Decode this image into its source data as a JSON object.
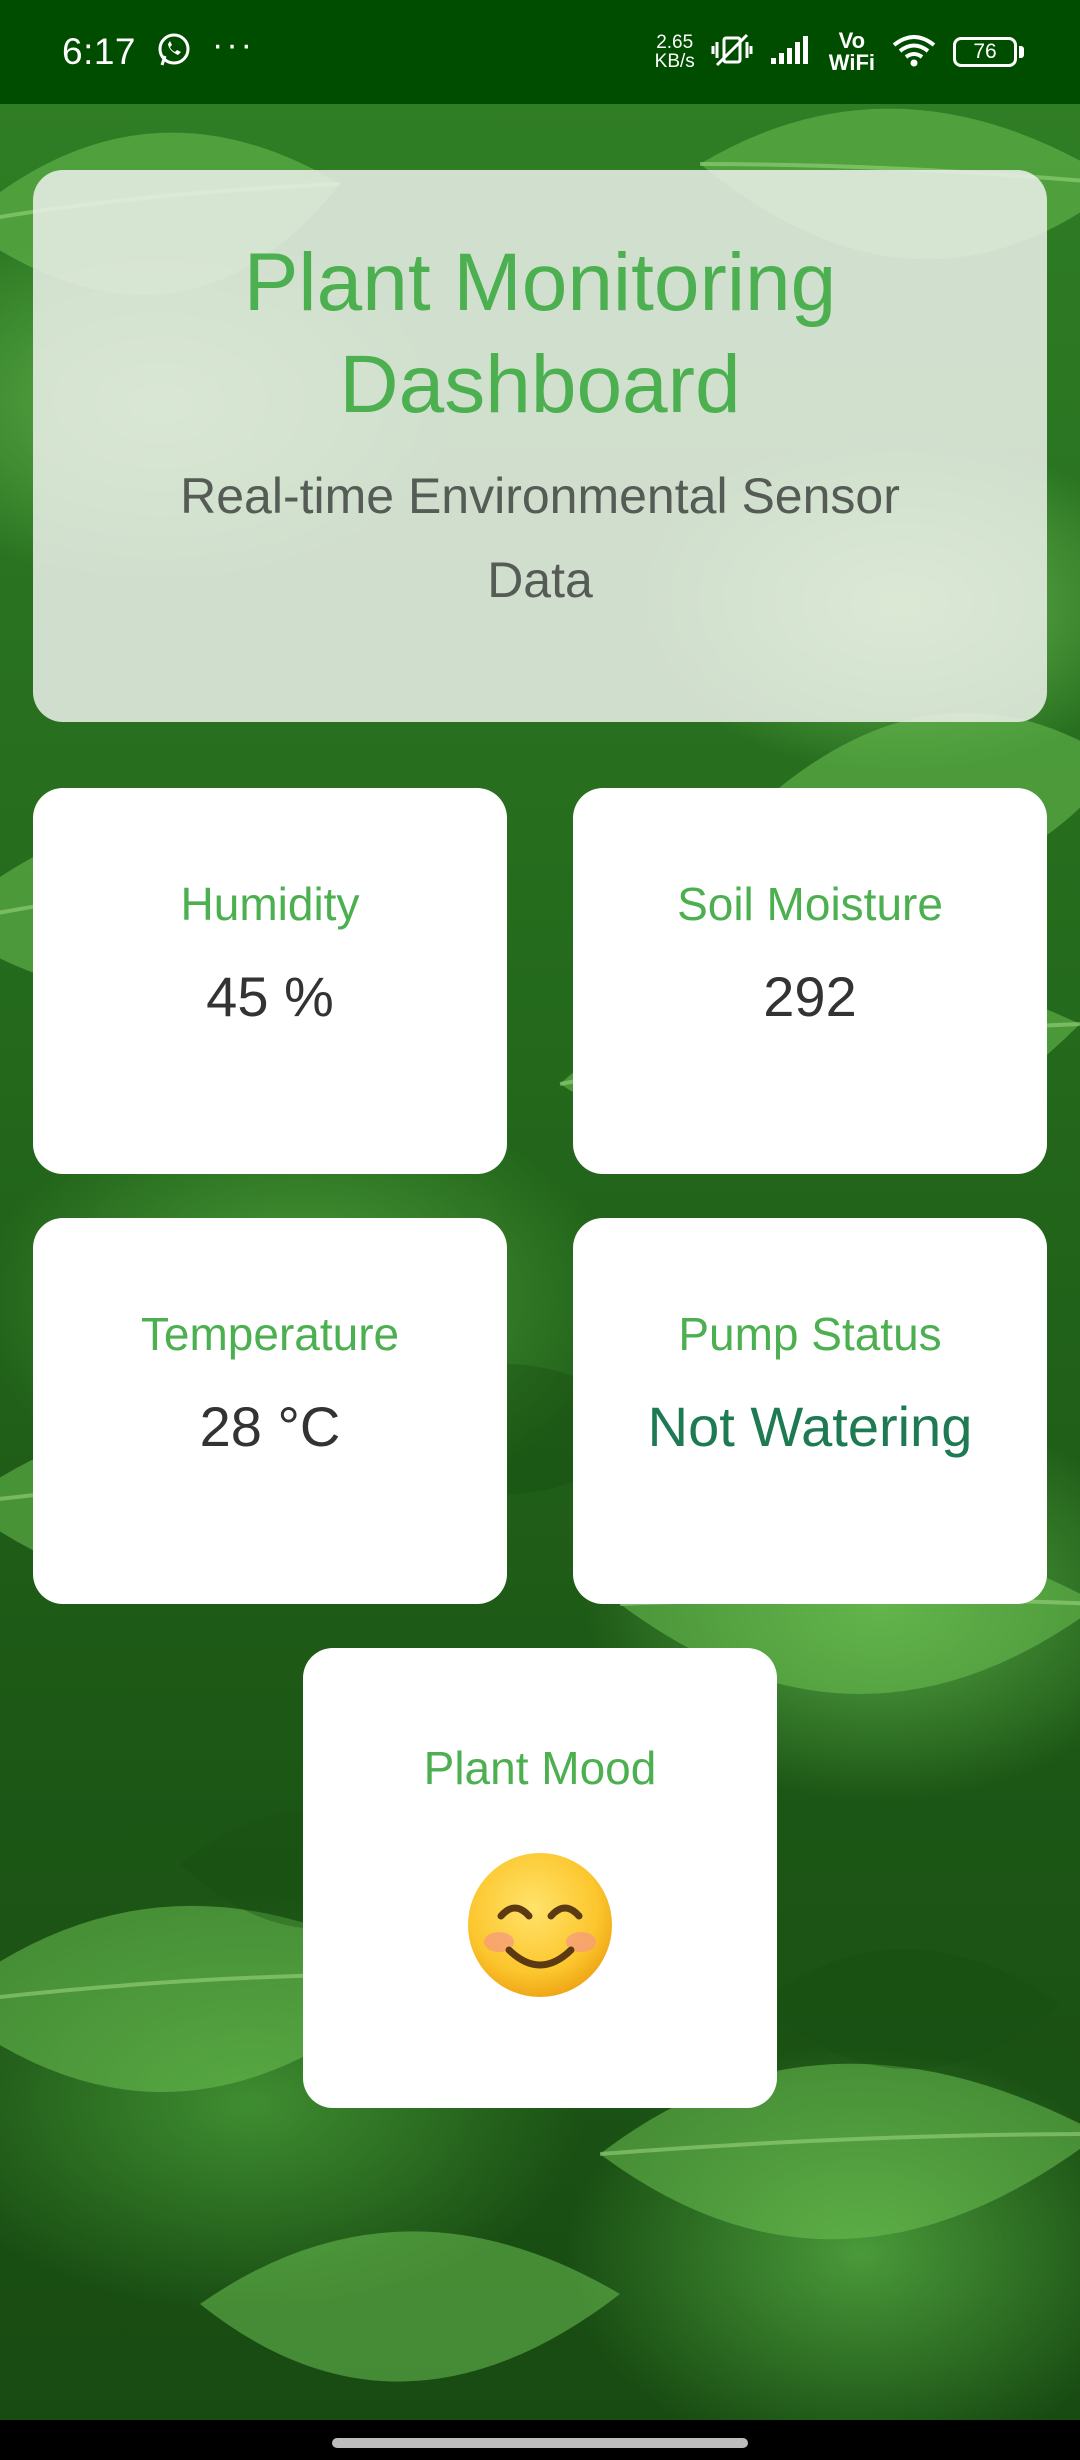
{
  "status_bar": {
    "time": "6:17",
    "more": "···",
    "net_speed_value": "2.65",
    "net_speed_unit": "KB/s",
    "vowifi_top": "Vo",
    "vowifi_bottom": "WiFi",
    "battery_level": "76",
    "icons": [
      "whatsapp-icon",
      "more-dots-icon",
      "vibrate-off-icon",
      "signal-icon",
      "wifi-icon",
      "battery-icon"
    ]
  },
  "header": {
    "title": "Plant Monitoring Dashboard",
    "subtitle": "Real-time Environmental Sensor Data"
  },
  "cards": {
    "humidity": {
      "label": "Humidity",
      "value": "45 %"
    },
    "soil_moisture": {
      "label": "Soil Moisture",
      "value": "292"
    },
    "temperature": {
      "label": "Temperature",
      "value": "28 °C"
    },
    "pump_status": {
      "label": "Pump Status",
      "value": "Not Watering"
    },
    "plant_mood": {
      "label": "Plant Mood",
      "emoji": "smiling-face-icon"
    }
  },
  "colors": {
    "status_bar": "#004d00",
    "accent": "#4caf50",
    "value_text": "#333333",
    "pump_status_text": "#1e7a52"
  }
}
